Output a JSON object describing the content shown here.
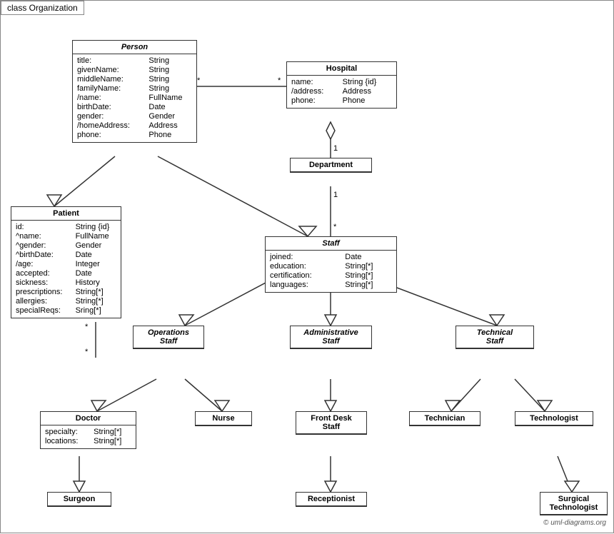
{
  "title": "class Organization",
  "classes": {
    "person": {
      "name": "Person",
      "italic": true,
      "attrs": [
        [
          "title:",
          "String"
        ],
        [
          "givenName:",
          "String"
        ],
        [
          "middleName:",
          "String"
        ],
        [
          "familyName:",
          "String"
        ],
        [
          "/name:",
          "FullName"
        ],
        [
          "birthDate:",
          "Date"
        ],
        [
          "gender:",
          "Gender"
        ],
        [
          "/homeAddress:",
          "Address"
        ],
        [
          "phone:",
          "Phone"
        ]
      ]
    },
    "hospital": {
      "name": "Hospital",
      "italic": false,
      "attrs": [
        [
          "name:",
          "String {id}"
        ],
        [
          "/address:",
          "Address"
        ],
        [
          "phone:",
          "Phone"
        ]
      ]
    },
    "patient": {
      "name": "Patient",
      "italic": false,
      "attrs": [
        [
          "id:",
          "String {id}"
        ],
        [
          "^name:",
          "FullName"
        ],
        [
          "^gender:",
          "Gender"
        ],
        [
          "^birthDate:",
          "Date"
        ],
        [
          "/age:",
          "Integer"
        ],
        [
          "accepted:",
          "Date"
        ],
        [
          "sickness:",
          "History"
        ],
        [
          "prescriptions:",
          "String[*]"
        ],
        [
          "allergies:",
          "String[*]"
        ],
        [
          "specialReqs:",
          "Sring[*]"
        ]
      ]
    },
    "department": {
      "name": "Department",
      "italic": false,
      "attrs": []
    },
    "staff": {
      "name": "Staff",
      "italic": true,
      "attrs": [
        [
          "joined:",
          "Date"
        ],
        [
          "education:",
          "String[*]"
        ],
        [
          "certification:",
          "String[*]"
        ],
        [
          "languages:",
          "String[*]"
        ]
      ]
    },
    "operationsStaff": {
      "name": "Operations\nStaff",
      "italic": true,
      "attrs": []
    },
    "administrativeStaff": {
      "name": "Administrative\nStaff",
      "italic": true,
      "attrs": []
    },
    "technicalStaff": {
      "name": "Technical\nStaff",
      "italic": true,
      "attrs": []
    },
    "doctor": {
      "name": "Doctor",
      "italic": false,
      "attrs": [
        [
          "specialty:",
          "String[*]"
        ],
        [
          "locations:",
          "String[*]"
        ]
      ]
    },
    "nurse": {
      "name": "Nurse",
      "italic": false,
      "attrs": []
    },
    "frontDeskStaff": {
      "name": "Front Desk\nStaff",
      "italic": false,
      "attrs": []
    },
    "technician": {
      "name": "Technician",
      "italic": false,
      "attrs": []
    },
    "technologist": {
      "name": "Technologist",
      "italic": false,
      "attrs": []
    },
    "surgeon": {
      "name": "Surgeon",
      "italic": false,
      "attrs": []
    },
    "receptionist": {
      "name": "Receptionist",
      "italic": false,
      "attrs": []
    },
    "surgicalTechnologist": {
      "name": "Surgical\nTechnologist",
      "italic": false,
      "attrs": []
    }
  },
  "watermark": "© uml-diagrams.org"
}
